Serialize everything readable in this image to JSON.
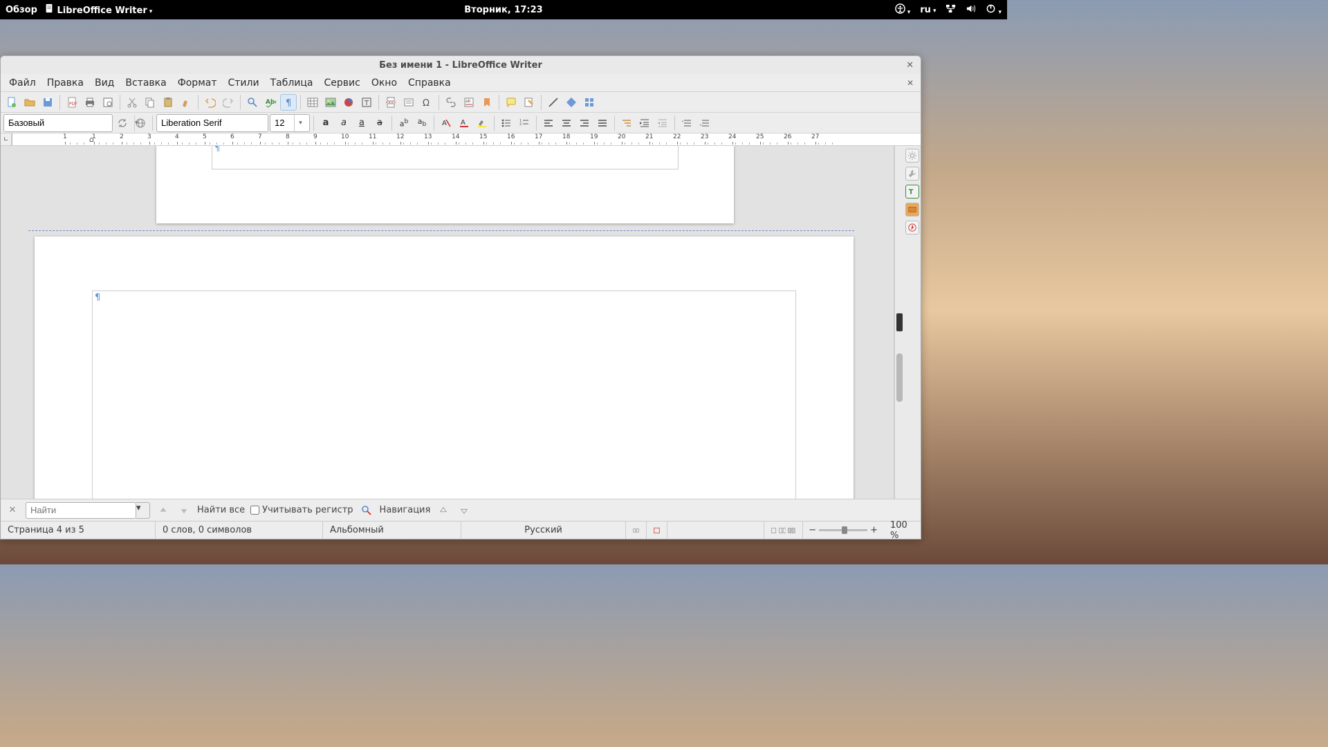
{
  "topbar": {
    "activities": "Обзор",
    "app_indicator": "LibreOffice Writer",
    "clock": "Вторник, 17:23",
    "keyboard": "ru"
  },
  "window": {
    "title": "Без имени 1 - LibreOffice Writer"
  },
  "menubar": {
    "items": [
      "Файл",
      "Правка",
      "Вид",
      "Вставка",
      "Формат",
      "Стили",
      "Таблица",
      "Сервис",
      "Окно",
      "Справка"
    ]
  },
  "formatting": {
    "paragraph_style": "Базовый",
    "font_name": "Liberation Serif",
    "font_size": "12"
  },
  "ruler": {
    "numbers": [
      "1",
      "1",
      "2",
      "3",
      "4",
      "5",
      "6",
      "7",
      "8",
      "9",
      "10",
      "11",
      "12",
      "13",
      "14",
      "15",
      "16",
      "17",
      "18",
      "19",
      "20",
      "21",
      "22",
      "23",
      "24",
      "25",
      "26",
      "27"
    ]
  },
  "findbar": {
    "placeholder": "Найти",
    "find_all": "Найти все",
    "match_case": "Учитывать регистр",
    "navigation": "Навигация"
  },
  "statusbar": {
    "page": "Страница 4 из 5",
    "words": "0 слов, 0 символов",
    "page_style": "Альбомный",
    "language": "Русский",
    "zoom": "100 %"
  }
}
